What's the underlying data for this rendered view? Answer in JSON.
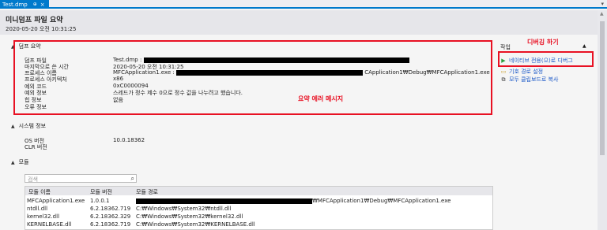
{
  "tab": {
    "label": "Test.dmp",
    "pin_glyph": "⊕",
    "close_glyph": "×",
    "dropdown_glyph": "▾"
  },
  "header": {
    "title": "미니덤프 파일 요약",
    "timestamp": "2020-05-20 오전 10:31:25"
  },
  "dump_summary": {
    "heading": "덤프 요약",
    "rows": [
      {
        "label": "덤프 파일",
        "value": "Test.dmp :",
        "suffix": ""
      },
      {
        "label": "마지막으로 쓴 시간",
        "value": "2020-05-20 오전 10:31:25",
        "suffix": ""
      },
      {
        "label": "프로세스 이름",
        "value": "MFCApplication1.exe :",
        "suffix": "CApplication1₩Debug₩MFCApplication1.exe"
      },
      {
        "label": "프로세스 아키텍처",
        "value": "x86",
        "suffix": ""
      },
      {
        "label": "예외 코드",
        "value": "0xC0000094",
        "suffix": ""
      },
      {
        "label": "예외 정보",
        "value": "스레드가 정수 제수 0으로 정수 값을 나누려고 했습니다.",
        "suffix": ""
      },
      {
        "label": "힙 정보",
        "value": "없음",
        "suffix": ""
      },
      {
        "label": "오류 정보",
        "value": "",
        "suffix": ""
      }
    ],
    "annotation": "요약 에러 메시지"
  },
  "system_info": {
    "heading": "시스템 정보",
    "rows": [
      {
        "label": "OS 버전",
        "value": "10.0.18362"
      },
      {
        "label": "CLR 버전",
        "value": ""
      }
    ]
  },
  "modules": {
    "heading": "모듈",
    "search_placeholder": "검색",
    "columns": [
      "모듈 이름",
      "모듈 버전",
      "모듈 경로"
    ],
    "rows": [
      {
        "name": "MFCApplication1.exe",
        "version": "1.0.0.1",
        "path": "₩MFCApplication1₩Debug₩MFCApplication1.exe"
      },
      {
        "name": "ntdll.dll",
        "version": "6.2.18362.719",
        "path": "C:₩Windows₩System32₩ntdll.dll"
      },
      {
        "name": "kernel32.dll",
        "version": "6.2.18362.329",
        "path": "C:₩Windows₩System32₩kernel32.dll"
      },
      {
        "name": "KERNELBASE.dll",
        "version": "6.2.18362.719",
        "path": "C:₩Windows₩System32₩KERNELBASE.dll"
      }
    ]
  },
  "actions": {
    "heading": "작업",
    "annotation": "디버깅 하기",
    "items": [
      {
        "label": "네이티브 전용(으)로 디버그",
        "icon": "play-icon",
        "glyph": "▶"
      },
      {
        "label": "기호 경로 설정",
        "icon": "folder-icon",
        "glyph": "▭"
      },
      {
        "label": "모두 클립보드로 복사",
        "icon": "copy-icon",
        "glyph": "⧉"
      }
    ]
  },
  "colors": {
    "accent": "#007acc",
    "annotation": "#e81123",
    "play": "#2e9e3f",
    "link": "#1a58c7"
  }
}
